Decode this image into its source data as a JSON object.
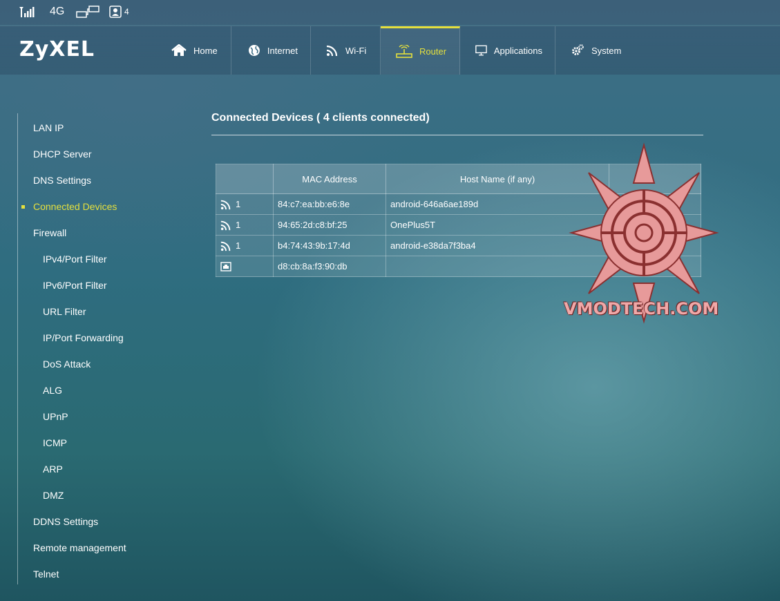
{
  "status_bar": {
    "network_type": "4G",
    "client_count": "4"
  },
  "brand": {
    "logo": "ZyXEL"
  },
  "nav": {
    "tabs": [
      {
        "label": "Home",
        "icon": "home-icon"
      },
      {
        "label": "Internet",
        "icon": "globe-icon"
      },
      {
        "label": "Wi-Fi",
        "icon": "wifi-icon"
      },
      {
        "label": "Router",
        "icon": "router-icon",
        "active": true
      },
      {
        "label": "Applications",
        "icon": "monitor-icon"
      },
      {
        "label": "System",
        "icon": "gear-icon"
      }
    ],
    "active_color": "#e5e03d"
  },
  "sidebar": {
    "items": [
      {
        "label": "LAN IP"
      },
      {
        "label": "DHCP Server"
      },
      {
        "label": "DNS Settings"
      },
      {
        "label": "Connected Devices",
        "active": true
      },
      {
        "label": "Firewall"
      },
      {
        "label": "IPv4/Port Filter"
      },
      {
        "label": "IPv6/Port Filter"
      },
      {
        "label": "URL Filter"
      },
      {
        "label": "IP/Port Forwarding"
      },
      {
        "label": "DoS Attack"
      },
      {
        "label": "ALG"
      },
      {
        "label": "UPnP"
      },
      {
        "label": "ICMP"
      },
      {
        "label": "ARP"
      },
      {
        "label": "DMZ"
      },
      {
        "label": "DDNS Settings"
      },
      {
        "label": "Remote management"
      },
      {
        "label": "Telnet"
      }
    ]
  },
  "main": {
    "title": "Connected Devices ( 4 clients connected)",
    "table": {
      "headers": [
        "",
        "MAC Address",
        "Host Name (if any)",
        ""
      ],
      "rows": [
        {
          "type_icon": "wifi-icon",
          "band": "1",
          "mac": "84:c7:ea:bb:e6:8e",
          "host": "android-646a6ae189d"
        },
        {
          "type_icon": "wifi-icon",
          "band": "1",
          "mac": "94:65:2d:c8:bf:25",
          "host": "OnePlus5T"
        },
        {
          "type_icon": "wifi-icon",
          "band": "1",
          "mac": "b4:74:43:9b:17:4d",
          "host": "android-e38da7f3ba4"
        },
        {
          "type_icon": "lan-icon",
          "band": "",
          "mac": "d8:cb:8a:f3:90:db",
          "host": ""
        }
      ]
    }
  },
  "watermark": {
    "text": "VMODTECH.COM"
  }
}
